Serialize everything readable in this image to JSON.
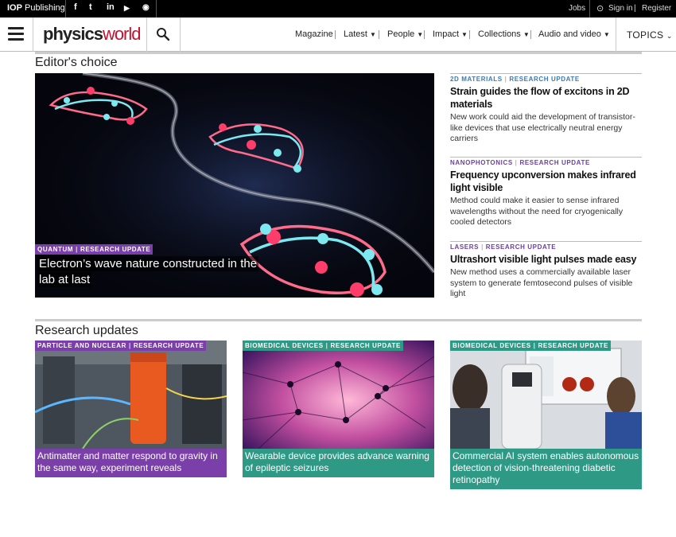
{
  "topbar": {
    "brand_bold": "IOP",
    "brand_rest": "Publishing",
    "social": [
      {
        "icon": "facebook-icon",
        "glyph": "f"
      },
      {
        "icon": "twitter-icon",
        "glyph": "t"
      },
      {
        "icon": "linkedin-icon",
        "glyph": "in"
      },
      {
        "icon": "youtube-icon",
        "glyph": "▶"
      },
      {
        "icon": "rss-icon",
        "glyph": "◉"
      }
    ],
    "jobs": "Jobs",
    "sign_in": "Sign in",
    "separator": "|",
    "register": "Register"
  },
  "nav": {
    "logo_main": "physics",
    "logo_accent": "world",
    "items": [
      {
        "label": "Magazine",
        "dropdown": false
      },
      {
        "label": "Latest",
        "dropdown": true
      },
      {
        "label": "People",
        "dropdown": true
      },
      {
        "label": "Impact",
        "dropdown": true
      },
      {
        "label": "Collections",
        "dropdown": true
      },
      {
        "label": "Audio and video",
        "dropdown": true
      }
    ],
    "topics": "TOPICS"
  },
  "editors_choice": {
    "heading": "Editor's choice",
    "hero": {
      "tag1": "QUANTUM",
      "tag2": "RESEARCH UPDATE",
      "headline_line1": "Electron’s wave nature constructed in the",
      "headline_line2": "lab at last"
    },
    "side": [
      {
        "cat1": "2D MATERIALS",
        "cat2": "RESEARCH UPDATE",
        "title": "Strain guides the flow of excitons in 2D materials",
        "desc": "New work could aid the development of transistor-like devices that use electrically neutral energy carriers"
      },
      {
        "cat1": "NANOPHOTONICS",
        "cat2": "RESEARCH UPDATE",
        "title": "Frequency upconversion makes infrared light visible",
        "desc": "Method could make it easier to sense infrared wavelengths without the need for cryogenically cooled detectors"
      },
      {
        "cat1": "LASERS",
        "cat2": "RESEARCH UPDATE",
        "title": "Ultrashort visible light pulses made easy",
        "desc": "New method uses a commercially available laser system to generate femtosecond pulses of visible light"
      }
    ]
  },
  "research_updates": {
    "heading": "Research updates",
    "cards": [
      {
        "tag1": "PARTICLE AND NUCLEAR",
        "tag2": "RESEARCH UPDATE",
        "caption": "Antimatter and matter respond to gravity in the same way, experiment reveals",
        "color": "#7a3fa8"
      },
      {
        "tag1": "BIOMEDICAL DEVICES",
        "tag2": "RESEARCH UPDATE",
        "caption": "Wearable device provides advance warning of epileptic seizures",
        "color": "#2e9a86"
      },
      {
        "tag1": "BIOMEDICAL DEVICES",
        "tag2": "RESEARCH UPDATE",
        "caption": "Commercial AI system enables autonomous detection of vision-threatening diabetic retinopathy",
        "color": "#2e9a86"
      }
    ]
  },
  "colors": {
    "purple": "#7a3fa8",
    "teal": "#2e9a86",
    "accent_red": "#c8102e"
  }
}
